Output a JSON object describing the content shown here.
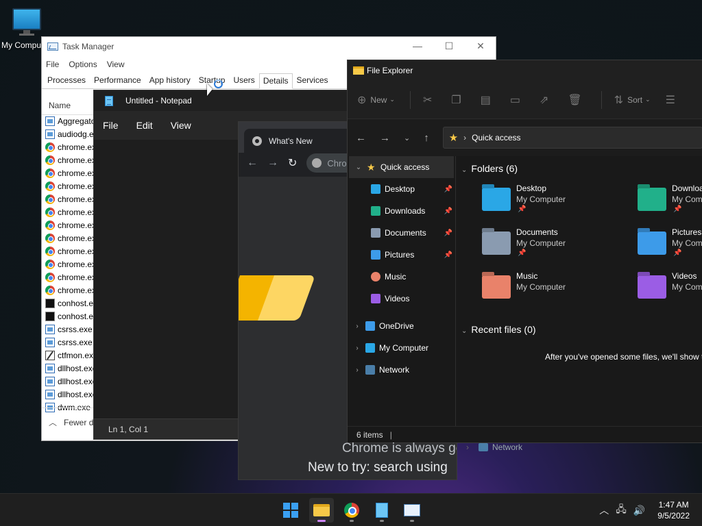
{
  "desktop": {
    "icon_label": "My Computer"
  },
  "task_manager": {
    "title": "Task Manager",
    "window_buttons": [
      "—",
      "☐",
      "✕"
    ],
    "menu": [
      "File",
      "Options",
      "View"
    ],
    "tabs": [
      "Processes",
      "Performance",
      "App history",
      "Startup",
      "Users",
      "Details",
      "Services"
    ],
    "active_tab": "Details",
    "column_name": "Name",
    "processes": [
      {
        "name": "AggregatorHost.exe",
        "icon": "window-icon"
      },
      {
        "name": "audiodg.exe",
        "icon": "window-icon"
      },
      {
        "name": "chrome.exe",
        "icon": "chrome-icon"
      },
      {
        "name": "chrome.exe",
        "icon": "chrome-icon"
      },
      {
        "name": "chrome.exe",
        "icon": "chrome-icon"
      },
      {
        "name": "chrome.exe",
        "icon": "chrome-icon"
      },
      {
        "name": "chrome.exe",
        "icon": "chrome-icon"
      },
      {
        "name": "chrome.exe",
        "icon": "chrome-icon"
      },
      {
        "name": "chrome.exe",
        "icon": "chrome-icon"
      },
      {
        "name": "chrome.exe",
        "icon": "chrome-icon"
      },
      {
        "name": "chrome.exe",
        "icon": "chrome-icon"
      },
      {
        "name": "chrome.exe",
        "icon": "chrome-icon"
      },
      {
        "name": "chrome.exe",
        "icon": "chrome-icon"
      },
      {
        "name": "chrome.exe",
        "icon": "chrome-icon"
      },
      {
        "name": "conhost.exe",
        "icon": "console-icon"
      },
      {
        "name": "conhost.exe",
        "icon": "console-icon"
      },
      {
        "name": "csrss.exe",
        "icon": "window-icon"
      },
      {
        "name": "csrss.exe",
        "icon": "window-icon"
      },
      {
        "name": "ctfmon.exe",
        "icon": "pen-icon"
      },
      {
        "name": "dllhost.exe",
        "icon": "window-icon"
      },
      {
        "name": "dllhost.exe",
        "icon": "window-icon"
      },
      {
        "name": "dllhost.exe",
        "icon": "window-icon"
      },
      {
        "name": "dwm.exe",
        "icon": "window-icon"
      }
    ],
    "footer_label": "Fewer details"
  },
  "notepad": {
    "title": "Untitled - Notepad",
    "menu": [
      "File",
      "Edit",
      "View"
    ],
    "status": "Ln 1, Col 1"
  },
  "chrome": {
    "tab_title": "What's New",
    "omnibox_text": "Chrome",
    "line1": "Chrome is always getting better",
    "line2": "New to try: search using"
  },
  "file_explorer": {
    "title": "File Explorer",
    "commands": {
      "new": "New",
      "sort": "Sort"
    },
    "address": "Quick access",
    "nav": [
      {
        "label": "Quick access",
        "level": 0,
        "expanded": true,
        "selected": true,
        "icon": "star-icon",
        "pinned": false
      },
      {
        "label": "Desktop",
        "level": 1,
        "icon": "desktop-icon",
        "pinned": true
      },
      {
        "label": "Downloads",
        "level": 1,
        "icon": "downloads-icon",
        "pinned": true
      },
      {
        "label": "Documents",
        "level": 1,
        "icon": "documents-icon",
        "pinned": true
      },
      {
        "label": "Pictures",
        "level": 1,
        "icon": "pictures-icon",
        "pinned": true
      },
      {
        "label": "Music",
        "level": 1,
        "icon": "music-icon",
        "pinned": false
      },
      {
        "label": "Videos",
        "level": 1,
        "icon": "videos-icon",
        "pinned": false
      },
      {
        "label": "OneDrive",
        "level": 0,
        "expanded": false,
        "icon": "cloud-icon",
        "pinned": false
      },
      {
        "label": "My Computer",
        "level": 0,
        "expanded": false,
        "icon": "computer-icon",
        "pinned": false
      },
      {
        "label": "Network",
        "level": 0,
        "expanded": false,
        "icon": "network-icon",
        "pinned": false
      }
    ],
    "folders_header": "Folders (6)",
    "folders": [
      {
        "name": "Desktop",
        "location": "My Computer",
        "color": "#2aa7e6",
        "pinned": true
      },
      {
        "name": "Downloads",
        "location": "My Computer",
        "color": "#21b08a",
        "pinned": true
      },
      {
        "name": "Documents",
        "location": "My Computer",
        "color": "#8a9bb0",
        "pinned": true
      },
      {
        "name": "Pictures",
        "location": "My Computer",
        "color": "#3d9be9",
        "pinned": true
      },
      {
        "name": "Music",
        "location": "My Computer",
        "color": "#e9826a",
        "pinned": false
      },
      {
        "name": "Videos",
        "location": "My Computer",
        "color": "#9b5de5",
        "pinned": false
      }
    ],
    "recent_header": "Recent files (0)",
    "empty_message": "After you've opened some files, we'll show the most recent ones here.",
    "status": "6 items"
  },
  "background_explorer": {
    "network_label": "Network"
  },
  "taskbar": {
    "apps": [
      "start-button",
      "file-explorer",
      "chrome",
      "notepad",
      "task-manager"
    ],
    "active_app": "file-explorer",
    "time": "1:47 AM",
    "date": "9/5/2022"
  },
  "colors": {
    "accent": "#3aa0f3",
    "folder_yellow": "#f7c948",
    "taskbar_indicator": "#d086ff"
  }
}
